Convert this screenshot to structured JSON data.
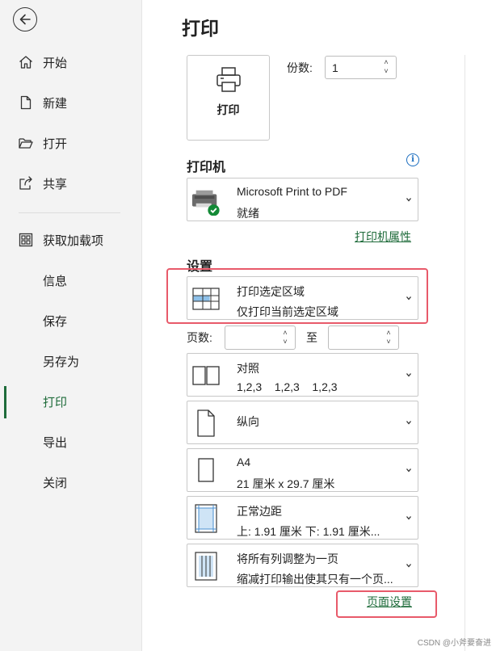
{
  "sidebar": {
    "items": [
      {
        "label": "开始",
        "icon": "home-icon"
      },
      {
        "label": "新建",
        "icon": "new-document-icon"
      },
      {
        "label": "打开",
        "icon": "folder-open-icon"
      },
      {
        "label": "共享",
        "icon": "share-icon"
      },
      {
        "label": "获取加载项",
        "icon": "add-ins-icon"
      },
      {
        "label": "信息"
      },
      {
        "label": "保存"
      },
      {
        "label": "另存为"
      },
      {
        "label": "打印",
        "active": true
      },
      {
        "label": "导出"
      },
      {
        "label": "关闭"
      }
    ]
  },
  "main": {
    "title": "打印",
    "print_button": "打印",
    "copies": {
      "label": "份数:",
      "value": "1"
    },
    "printer": {
      "heading": "打印机",
      "name": "Microsoft Print to PDF",
      "status": "就绪",
      "properties_link": "打印机属性"
    },
    "settings": {
      "heading": "设置",
      "print_area": {
        "title": "打印选定区域",
        "desc": "仅打印当前选定区域"
      },
      "pages": {
        "label": "页数:",
        "to": "至",
        "from_value": "",
        "to_value": ""
      },
      "collate": {
        "title": "对照",
        "desc": "1,2,3    1,2,3    1,2,3"
      },
      "orientation": {
        "title": "纵向"
      },
      "paper": {
        "title": "A4",
        "desc": "21 厘米 x 29.7 厘米"
      },
      "margins": {
        "title": "正常边距",
        "desc": "上: 1.91 厘米 下: 1.91 厘米..."
      },
      "scaling": {
        "title": "将所有列调整为一页",
        "desc": "缩减打印输出使其只有一个页..."
      },
      "page_setup_link": "页面设置"
    }
  },
  "watermark": "CSDN @小斧要奋进",
  "colors": {
    "accent": "#1e6b3a",
    "highlight": "#e85a6a",
    "link_info": "#1a6dbf"
  }
}
